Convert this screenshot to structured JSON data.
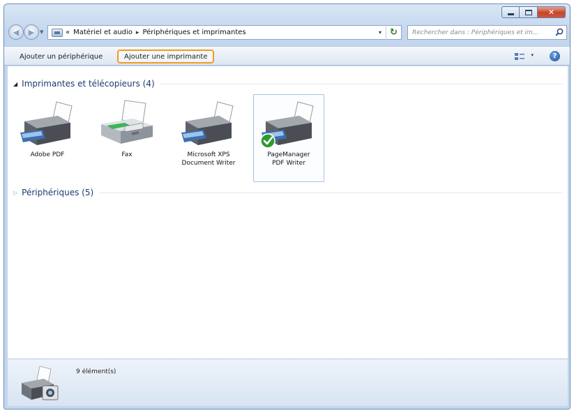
{
  "window": {
    "caption": {
      "minimize": "–",
      "maximize": "",
      "close": "✕"
    }
  },
  "address": {
    "overflow": "«",
    "crumbs": [
      "Matériel et audio",
      "Périphériques et imprimantes"
    ],
    "separator": "▸",
    "dropdown": "▾",
    "refresh": "↻"
  },
  "search": {
    "placeholder": "Rechercher dans : Périphériques et im..."
  },
  "toolbar": {
    "add_device": "Ajouter un périphérique",
    "add_printer": "Ajouter une imprimante",
    "view_dropdown": "▾",
    "help": "?"
  },
  "groups": {
    "printers": {
      "arrow": "◢",
      "title": "Imprimantes et télécopieurs (4)"
    },
    "devices": {
      "arrow": "▷",
      "title": "Périphériques (5)"
    }
  },
  "printers": [
    {
      "label": "Adobe PDF",
      "icon": "printer-icon"
    },
    {
      "label": "Fax",
      "icon": "fax-icon"
    },
    {
      "label": "Microsoft XPS\nDocument Writer",
      "icon": "printer-icon"
    },
    {
      "label": "PageManager\nPDF Writer",
      "icon": "printer-icon",
      "default": true
    }
  ],
  "details": {
    "count": "9 élément(s)"
  },
  "colors": {
    "highlight": "#f39a1c",
    "selection_border": "#a7c2e6",
    "group_title": "#1c3a73",
    "default_check": "#2f9a2f"
  }
}
